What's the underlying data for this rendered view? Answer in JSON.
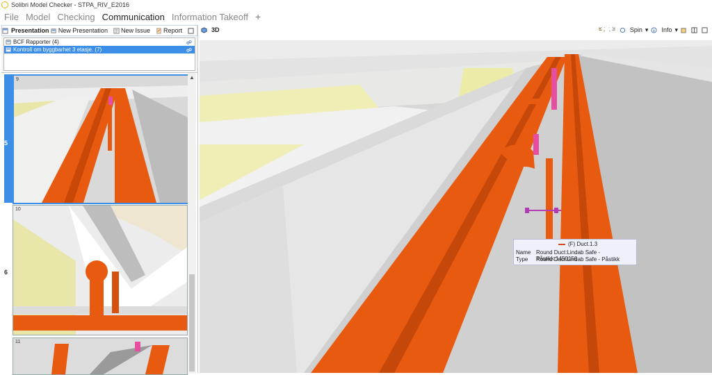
{
  "window": {
    "title": "Solibri Model Checker - STPA_RIV_E2016"
  },
  "menu": {
    "items": [
      "File",
      "Model",
      "Checking",
      "Communication",
      "Information Takeoff"
    ],
    "active_index": 3,
    "add_label": "+"
  },
  "presentation_panel": {
    "title": "Presentation",
    "new_presentation": "New Presentation",
    "new_issue": "New Issue",
    "report": "Report",
    "rows": [
      {
        "label": "BCF Rapporter (4)",
        "selected": false
      },
      {
        "label": "Kontroll om byggbarhet 3 etasje. (7)",
        "selected": true
      }
    ]
  },
  "slides": [
    {
      "slide_number": "5",
      "view_number": "9",
      "selected": true
    },
    {
      "slide_number": "6",
      "view_number": "10",
      "selected": false
    },
    {
      "slide_number": "",
      "view_number": "11",
      "selected": false
    }
  ],
  "view3d": {
    "label": "3D",
    "toolbar": {
      "spin": "Spin",
      "info": "Info"
    }
  },
  "tooltip": {
    "title": "(F) Duct.1.3",
    "name_key": "Name",
    "name_value": "Round Duct:Lindab Safe - Påstikk:1450156",
    "type_key": "Type",
    "type_value": "Round Duct:Lindab Safe - Påstikk"
  },
  "colors": {
    "accent": "#3d8ee6",
    "duct": "#e85a10",
    "wall": "#d8d8d8",
    "floor": "#efeeb4"
  }
}
